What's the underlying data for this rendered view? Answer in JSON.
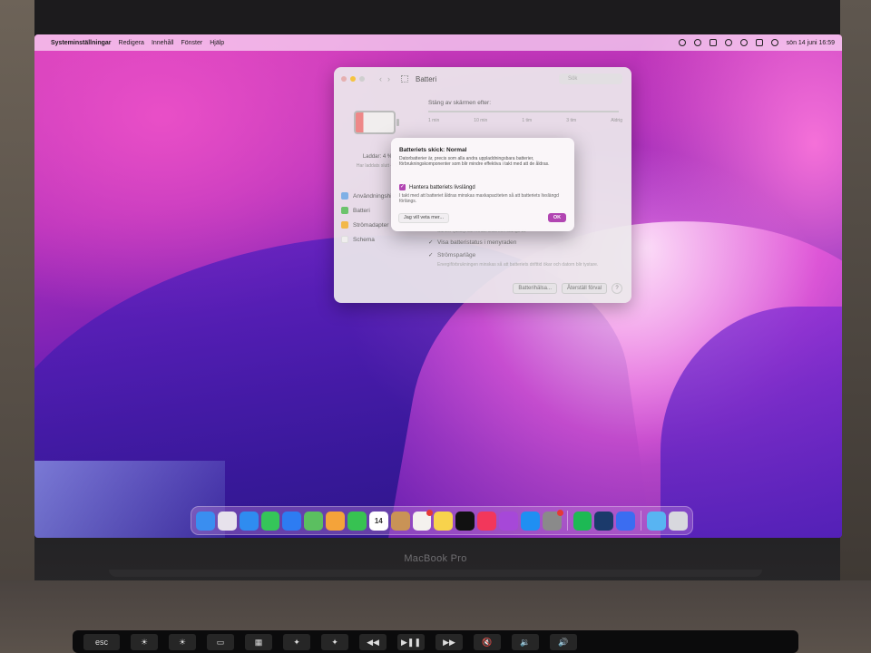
{
  "menubar": {
    "apple_glyph": "",
    "items": [
      "Systeminställningar",
      "Redigera",
      "Innehåll",
      "Fönster",
      "Hjälp"
    ],
    "status_icons": [
      "screen-record-icon",
      "focus-icon",
      "battery-icon",
      "wifi-icon",
      "search-icon",
      "control-center-icon",
      "siri-icon"
    ],
    "clock": "sön 14 juni 16:59"
  },
  "window": {
    "title": "Batteri",
    "search_placeholder": "Sök",
    "sidebar": {
      "charge_text": "Laddar: 4 %",
      "charge_sub": "Har laddats slutt 4 %",
      "items": [
        "Användningshistorik",
        "Batteri",
        "Strömadapter",
        "Schema"
      ]
    },
    "main": {
      "sleep_label": "Stäng av skärmen efter:",
      "ticks": [
        "1 min",
        "10 min",
        "1 tim",
        "3 tim",
        "Aldrig"
      ],
      "options": [
        {
          "label": "Visa batteristatus i menyraden",
          "checked": true
        },
        {
          "label": "Strömsparläge",
          "checked": true
        }
      ],
      "option_desc": "Energiförbrukningen minskas så att batteriets drifttid ökar och datorn blir tystare.",
      "behind_sheet_desc": "Sänker ljusstyrkan innan skärmen stängs av",
      "buttons": {
        "health": "Batterihälsa...",
        "restore": "Återställ förval",
        "help": "?"
      }
    }
  },
  "sheet": {
    "title": "Batteriets skick: Normal",
    "body": "Datorbatterier är, precis som alla andra uppladdningsbara batterier, förbrukningskomponenter som blir mindre effektiva i takt med att de åldras.",
    "check_label": "Hantera batteriets livslängd",
    "check_glyph": "✓",
    "check_desc": "I takt med att batteriet åldras minskas maxkapaciteten så att batteriets livslängd förlängs.",
    "learn_more": "Jag vill veta mer...",
    "ok": "OK"
  },
  "dock": {
    "apps": [
      {
        "name": "finder-icon",
        "color": "#3a8ef0"
      },
      {
        "name": "launchpad-icon",
        "color": "#e7e2ec"
      },
      {
        "name": "safari-icon",
        "color": "#2f8cf0"
      },
      {
        "name": "messages-icon",
        "color": "#35c559"
      },
      {
        "name": "mail-icon",
        "color": "#2d7cf2"
      },
      {
        "name": "maps-icon",
        "color": "#5bbf60"
      },
      {
        "name": "photos-icon",
        "color": "#f4a33a"
      },
      {
        "name": "facetime-icon",
        "color": "#37c252"
      },
      {
        "name": "calendar-icon",
        "color": "#ffffff",
        "text": "14"
      },
      {
        "name": "contacts-icon",
        "color": "#c99356"
      },
      {
        "name": "reminders-icon",
        "color": "#f4f1ee",
        "badge": true
      },
      {
        "name": "notes-icon",
        "color": "#f8d34c"
      },
      {
        "name": "apple-tv-icon",
        "color": "#111111"
      },
      {
        "name": "music-icon",
        "color": "#f2375b"
      },
      {
        "name": "podcasts-icon",
        "color": "#a648d8"
      },
      {
        "name": "app-store-icon",
        "color": "#1f8ff2"
      },
      {
        "name": "system-settings-icon",
        "color": "#8a8a8a",
        "badge": true
      }
    ],
    "apps2": [
      {
        "name": "spotify-icon",
        "color": "#1db954"
      },
      {
        "name": "steam-icon",
        "color": "#1b3a6b"
      },
      {
        "name": "nordvpn-icon",
        "color": "#3b6df1"
      }
    ],
    "apps3": [
      {
        "name": "downloads-folder-icon",
        "color": "#58b4f2"
      },
      {
        "name": "trash-icon",
        "color": "#d8d8de"
      }
    ]
  },
  "device": {
    "brand": "MacBook Pro",
    "touchbar": [
      "esc",
      "☀",
      "☀",
      "▭",
      "▦",
      "✦",
      "✦",
      "◀◀",
      "▶❚❚",
      "▶▶",
      "🔇",
      "🔉",
      "🔊"
    ]
  }
}
